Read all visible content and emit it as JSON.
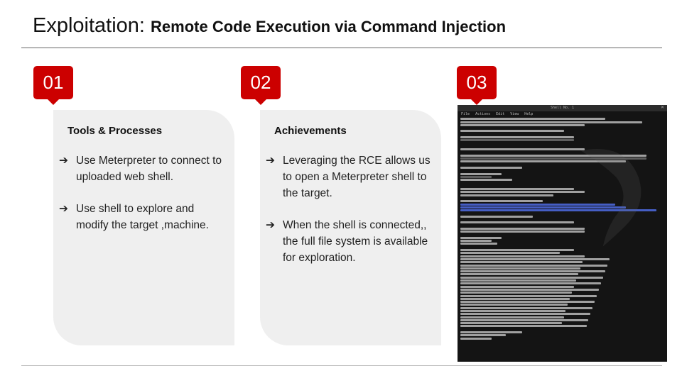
{
  "header": {
    "title_main": "Exploitation: ",
    "title_sub": "Remote Code Execution via Command Injection"
  },
  "steps": [
    {
      "number": "01",
      "heading": "Tools & Processes",
      "bullets": [
        "Use Meterpreter to connect to uploaded web shell.",
        "Use shell to explore and modify the target ,machine."
      ]
    },
    {
      "number": "02",
      "heading": "Achievements",
      "bullets": [
        "Leveraging the RCE allows us to open a Meterpreter shell to the target.",
        "When the shell is connected,, the full file system is available for exploration."
      ]
    },
    {
      "number": "03"
    }
  ],
  "bullet_arrow": "➔",
  "terminal": {
    "window_title": "Shell No. 1",
    "menu": [
      "File",
      "Actions",
      "Edit",
      "View",
      "Help"
    ]
  },
  "colors": {
    "accent": "#cc0000",
    "card_bg": "#efefef",
    "terminal_bg": "#141414"
  }
}
